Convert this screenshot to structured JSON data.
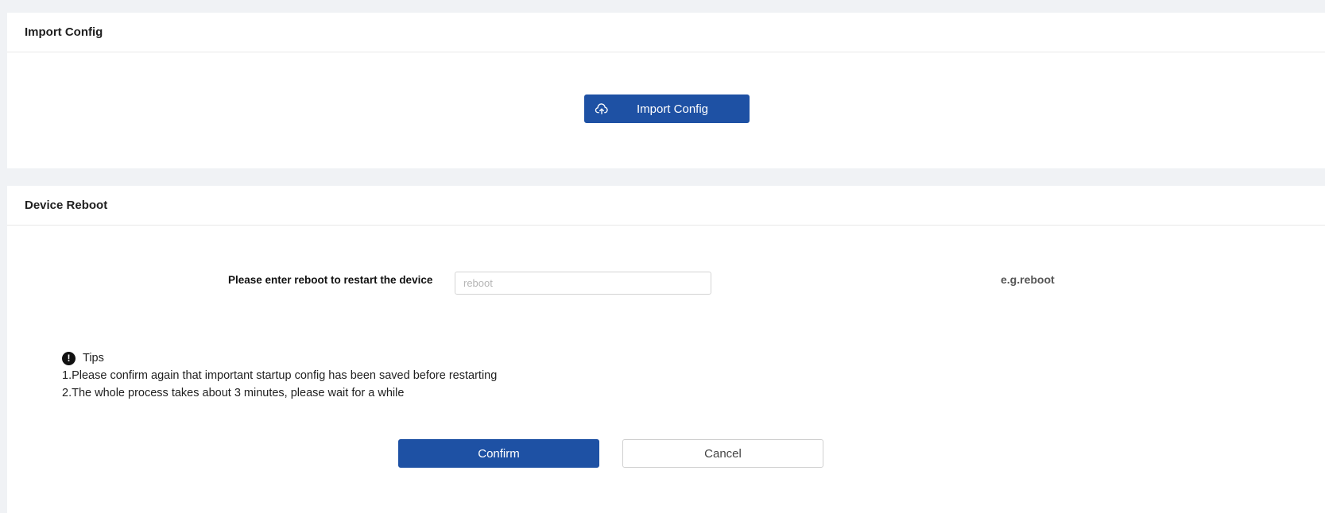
{
  "import_section": {
    "title": "Import Config",
    "button_label": "Import Config",
    "button_icon": "cloud-upload-icon"
  },
  "reboot_section": {
    "title": "Device Reboot",
    "field_label": "Please enter reboot to restart the device",
    "input_value": "",
    "input_placeholder": "reboot",
    "hint": "e.g.reboot",
    "tips": {
      "icon": "exclamation-circle-icon",
      "title": "Tips",
      "items": [
        "1.Please confirm again that important startup config has been saved before restarting",
        "2.The whole process takes about 3 minutes, please wait for a while"
      ]
    },
    "confirm_label": "Confirm",
    "cancel_label": "Cancel"
  },
  "colors": {
    "primary": "#1e51a4",
    "background": "#f0f2f5",
    "card": "#ffffff"
  }
}
